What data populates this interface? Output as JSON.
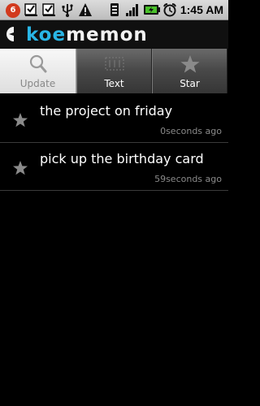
{
  "status_bar": {
    "notification_count": "6",
    "time": "1:45 AM",
    "icons": [
      "notification-badge-icon",
      "checklist-icon",
      "download-icon",
      "usb-icon",
      "warning-icon",
      "vibrate-icon",
      "signal-icon",
      "battery-icon",
      "alarm-icon"
    ]
  },
  "app": {
    "title_accent": "koe",
    "title_rest": "memon",
    "logo_icon": "koe-logo-icon",
    "accent_color": "#29b6e6"
  },
  "tabs": [
    {
      "label": "Update",
      "icon": "search-icon",
      "active": true
    },
    {
      "label": "Text",
      "icon": "text-icon",
      "active": false
    },
    {
      "label": "Star",
      "icon": "star-icon",
      "active": false
    }
  ],
  "memos": [
    {
      "text": "the project on friday",
      "time": "0seconds ago",
      "icon": "star-icon"
    },
    {
      "text": "pick up the birthday card",
      "time": "59seconds ago",
      "icon": "star-icon"
    }
  ]
}
